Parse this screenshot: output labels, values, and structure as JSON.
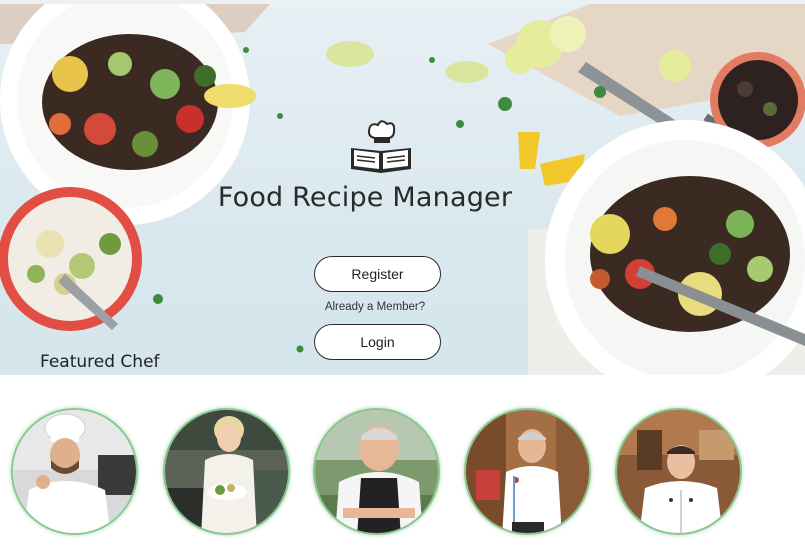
{
  "app": {
    "title": "Food Recipe Manager"
  },
  "auth": {
    "register_label": "Register",
    "member_prompt": "Already a Member?",
    "login_label": "Login"
  },
  "featured": {
    "title": "Featured Chef",
    "chefs": [
      {
        "icon": "chef-photo-1-icon"
      },
      {
        "icon": "chef-photo-2-icon"
      },
      {
        "icon": "chef-photo-3-icon"
      },
      {
        "icon": "chef-photo-4-icon"
      },
      {
        "icon": "chef-photo-5-icon"
      }
    ]
  },
  "theme": {
    "hero_background": "#dbe9ef",
    "button_border": "#2b2b2b",
    "chef_ring": "#86c98f"
  },
  "icons": {
    "logo": "chef-hat-book-icon"
  }
}
